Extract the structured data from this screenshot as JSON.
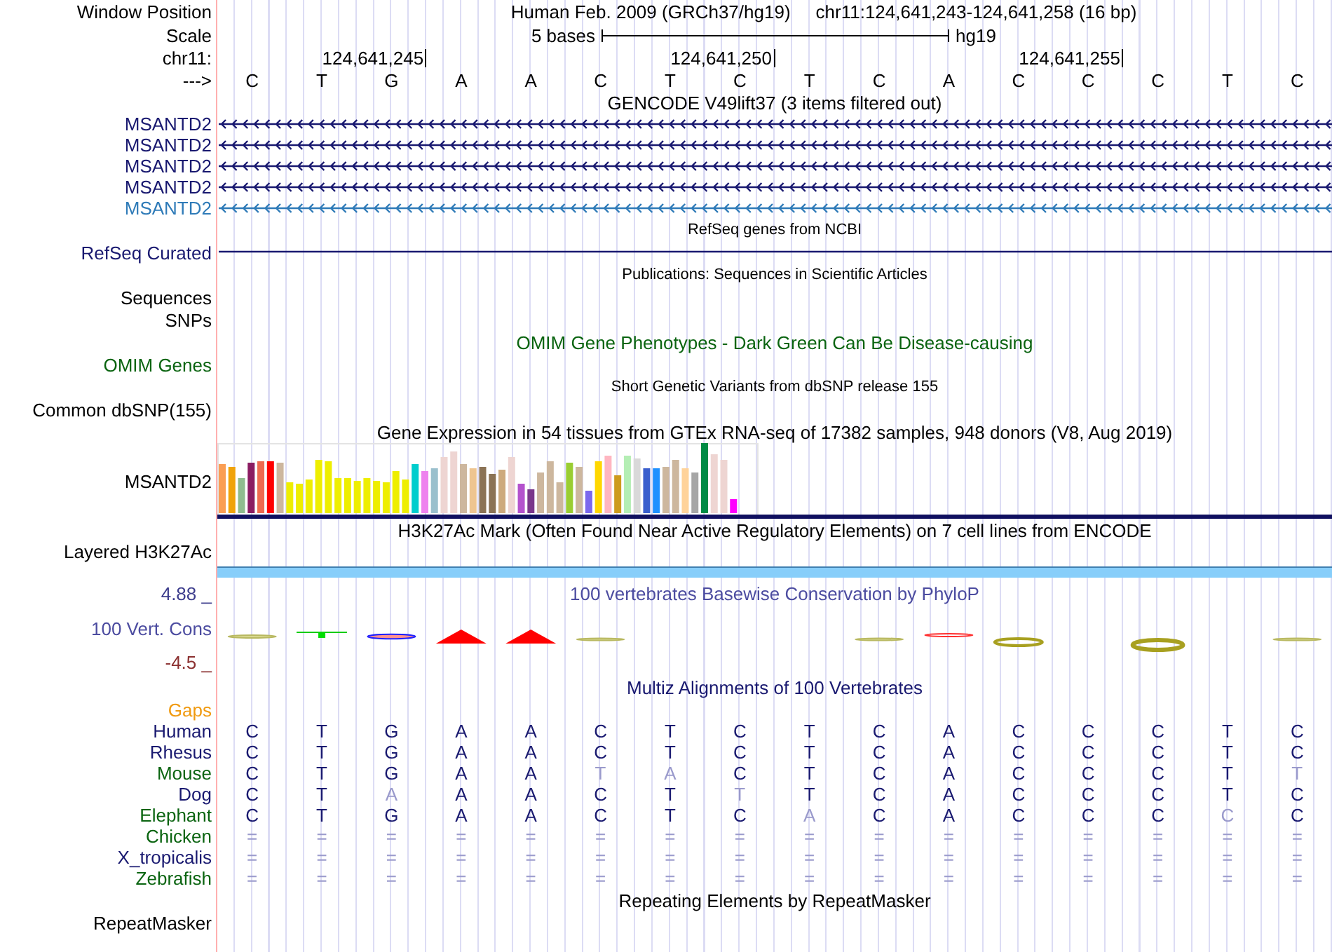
{
  "header": {
    "label": "Window Position",
    "assembly": "Human Feb. 2009 (GRCh37/hg19)",
    "position": "chr11:124,641,243-124,641,258 (16 bp)"
  },
  "scale": {
    "label": "Scale",
    "span": "5 bases",
    "database": "hg19"
  },
  "ruler": {
    "label": "chr11:",
    "ticks": [
      "124,641,245",
      "124,641,250",
      "124,641,255"
    ]
  },
  "sequence": {
    "label": "--->",
    "bases": [
      "C",
      "T",
      "G",
      "A",
      "A",
      "C",
      "T",
      "C",
      "T",
      "C",
      "A",
      "C",
      "C",
      "C",
      "T",
      "C"
    ]
  },
  "tracks": [
    {
      "kind": "title",
      "text": "GENCODE V49lift37 (3 items filtered out)"
    },
    {
      "kind": "gene",
      "label": "MSANTD2",
      "color": "#191970"
    },
    {
      "kind": "gene",
      "label": "MSANTD2",
      "color": "#191970"
    },
    {
      "kind": "gene",
      "label": "MSANTD2",
      "color": "#191970"
    },
    {
      "kind": "gene",
      "label": "MSANTD2",
      "color": "#191970"
    },
    {
      "kind": "gene",
      "label": "MSANTD2",
      "color": "#2f7bb8"
    },
    {
      "kind": "small_title",
      "text": "RefSeq genes from NCBI"
    },
    {
      "kind": "line",
      "label": "RefSeq Curated",
      "color": "#191970"
    },
    {
      "kind": "small_title",
      "text": "Publications: Sequences in Scientific Articles"
    },
    {
      "kind": "label",
      "label": "Sequences"
    },
    {
      "kind": "label",
      "label": "SNPs"
    },
    {
      "kind": "title",
      "text": "OMIM Gene Phenotypes - Dark Green Can Be Disease-causing",
      "color": "#0a6410"
    },
    {
      "kind": "label",
      "label": "OMIM Genes",
      "color": "#0a6410"
    },
    {
      "kind": "small_title",
      "text": "Short Genetic Variants from dbSNP release 155"
    },
    {
      "kind": "label",
      "label": "Common dbSNP(155)"
    },
    {
      "kind": "title",
      "text": "Gene Expression in 54 tissues from GTEx RNA-seq of 17382 samples, 948 donors (V8, Aug 2019)"
    },
    {
      "kind": "expression",
      "label": "MSANTD2"
    },
    {
      "kind": "title",
      "text": "H3K27Ac Mark (Often Found Near Active Regulatory Elements) on 7 cell lines from ENCODE"
    },
    {
      "kind": "signal",
      "label": "Layered H3K27Ac"
    },
    {
      "kind": "phylop",
      "title": "100 vertebrates Basewise Conservation by PhyloP",
      "label": "100 Vert. Cons",
      "max": "4.88 _",
      "min": "-4.5 _",
      "color": "#4c4ca0"
    },
    {
      "kind": "title",
      "text": "Multiz Alignments of 100 Vertebrates",
      "color": "#191970"
    },
    {
      "kind": "label",
      "label": "Gaps",
      "color": "#f09a10"
    },
    {
      "kind": "alignment",
      "label": "Human",
      "color": "#191970",
      "bases": [
        "C",
        "T",
        "G",
        "A",
        "A",
        "C",
        "T",
        "C",
        "T",
        "C",
        "A",
        "C",
        "C",
        "C",
        "T",
        "C"
      ]
    },
    {
      "kind": "alignment",
      "label": "Rhesus",
      "color": "#191970",
      "bases": [
        "C",
        "T",
        "G",
        "A",
        "A",
        "C",
        "T",
        "C",
        "T",
        "C",
        "A",
        "C",
        "C",
        "C",
        "T",
        "C"
      ]
    },
    {
      "kind": "alignment",
      "label": "Mouse",
      "color": "#0a6410",
      "bases": [
        "C",
        "T",
        "G",
        "A",
        "A",
        "T",
        "A",
        "C",
        "T",
        "C",
        "A",
        "C",
        "C",
        "C",
        "T",
        "T"
      ]
    },
    {
      "kind": "alignment",
      "label": "Dog",
      "color": "#191970",
      "bases": [
        "C",
        "T",
        "A",
        "A",
        "A",
        "C",
        "T",
        "T",
        "T",
        "C",
        "A",
        "C",
        "C",
        "C",
        "T",
        "C"
      ]
    },
    {
      "kind": "alignment",
      "label": "Elephant",
      "color": "#0a6410",
      "bases": [
        "C",
        "T",
        "G",
        "A",
        "A",
        "C",
        "T",
        "C",
        "A",
        "C",
        "A",
        "C",
        "C",
        "C",
        "C",
        "C"
      ]
    },
    {
      "kind": "alignment",
      "label": "Chicken",
      "color": "#0a6410",
      "bases": [
        "=",
        "=",
        "=",
        "=",
        "=",
        "=",
        "=",
        "=",
        "=",
        "=",
        "=",
        "=",
        "=",
        "=",
        "=",
        "="
      ]
    },
    {
      "kind": "alignment",
      "label": "X_tropicalis",
      "color": "#191970",
      "bases": [
        "=",
        "=",
        "=",
        "=",
        "=",
        "=",
        "=",
        "=",
        "=",
        "=",
        "=",
        "=",
        "=",
        "=",
        "=",
        "="
      ]
    },
    {
      "kind": "alignment",
      "label": "Zebrafish",
      "color": "#0a6410",
      "bases": [
        "=",
        "=",
        "=",
        "=",
        "=",
        "=",
        "=",
        "=",
        "=",
        "=",
        "=",
        "=",
        "=",
        "=",
        "=",
        "="
      ]
    },
    {
      "kind": "title",
      "text": "Repeating Elements by RepeatMasker"
    },
    {
      "kind": "label",
      "label": "RepeatMasker"
    }
  ]
}
